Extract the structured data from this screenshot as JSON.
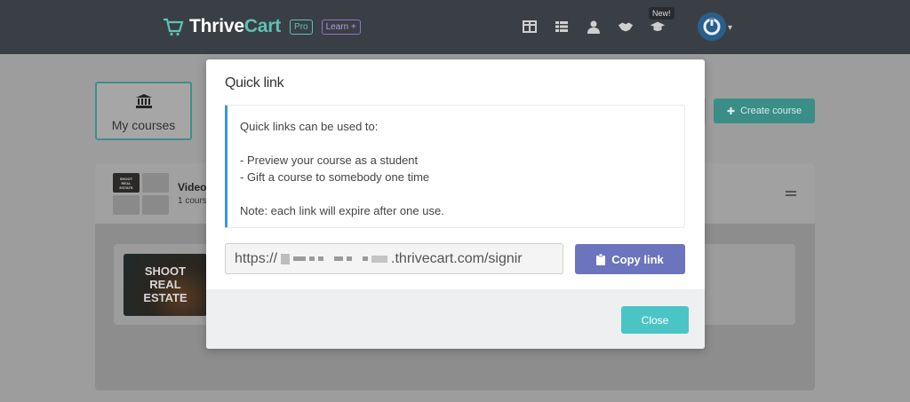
{
  "header": {
    "brand_prefix": "Thrive",
    "brand_suffix": "Cart",
    "pill_pro": "Pro",
    "pill_learn": "Learn +",
    "new_badge": "New!",
    "nav_icons": [
      "layout-icon",
      "list-icon",
      "user-icon",
      "handshake-icon",
      "graduation-cap-icon"
    ]
  },
  "background": {
    "my_courses_label": "My courses",
    "create_course_label": "Create course",
    "bundle_title": "Video",
    "bundle_subtitle": "1 cours",
    "thumb_small_text": "SHOOT\nREAL\nESTATE",
    "card_thumb_text": "SHOOT\nREAL\nESTATE"
  },
  "modal": {
    "title": "Quick link",
    "info_intro": "Quick links can be used to:",
    "info_item_1": "- Preview your course as a student",
    "info_item_2": "- Gift a course to somebody one time",
    "info_note": "Note: each link will expire after one use.",
    "link_prefix": "https://",
    "link_suffix": ".thrivecart.com/signir",
    "copy_label": "Copy link",
    "close_label": "Close"
  },
  "colors": {
    "accent_teal": "#4bc4c6",
    "copy_button": "#6b74bd",
    "info_border": "#3b98d6"
  }
}
